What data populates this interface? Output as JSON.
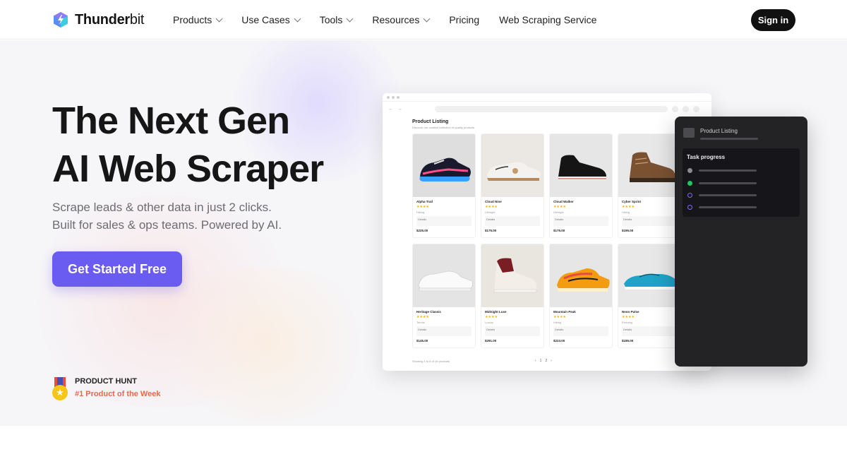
{
  "header": {
    "logo_bold": "Thunder",
    "logo_light": "bit",
    "nav": [
      {
        "label": "Products",
        "dropdown": true
      },
      {
        "label": "Use Cases",
        "dropdown": true
      },
      {
        "label": "Tools",
        "dropdown": true
      },
      {
        "label": "Resources",
        "dropdown": true
      },
      {
        "label": "Pricing",
        "dropdown": false
      },
      {
        "label": "Web Scraping Service",
        "dropdown": false
      }
    ],
    "signin_label": "Sign in"
  },
  "hero": {
    "title_line1": "The Next Gen",
    "title_line2": "AI Web Scraper",
    "subtitle_line1": "Scrape leads & other data in just 2 clicks.",
    "subtitle_line2": "Built for sales & ops teams. Powered by AI.",
    "cta_label": "Get Started Free",
    "badge_top": "PRODUCT HUNT",
    "badge_bottom": "#1 Product of the Week"
  },
  "mockup": {
    "listing_title": "Product Listing",
    "listing_subtitle": "Discover our curated collection of quality products",
    "products": [
      {
        "name": "Alpha Trail",
        "stars": "★★★★",
        "category": "Hiking",
        "price": "$225.00"
      },
      {
        "name": "Cloud Nine",
        "stars": "★★★★",
        "category": "Lifestyle",
        "price": "$175.00"
      },
      {
        "name": "Cloud Walker",
        "stars": "★★★★",
        "category": "Lifestyle",
        "price": "$175.00"
      },
      {
        "name": "Cyber Sprint",
        "stars": "★★★★",
        "category": "Hiking",
        "price": "$195.00"
      },
      {
        "name": "Heritage Classic",
        "stars": "★★★★",
        "category": "Tennis",
        "price": "$145.00"
      },
      {
        "name": "Midnight Luxe",
        "stars": "★★★★",
        "category": "Luxury",
        "price": "$291.00"
      },
      {
        "name": "Mountain Peak",
        "stars": "★★★★",
        "category": "Hiking",
        "price": "$223.00"
      },
      {
        "name": "Neon Pulse",
        "stars": "★★★★",
        "category": "Running",
        "price": "$185.00"
      }
    ],
    "product_desc": "Details",
    "footer_text": "Showing 1 to 8 of 16 products",
    "pager": [
      "‹",
      "1",
      "2",
      "›"
    ]
  },
  "panel": {
    "header_label": "Product Listing",
    "task_title": "Task progress",
    "task_rows": [
      {
        "status": "done",
        "color": "#8a8a90"
      },
      {
        "status": "active",
        "color": "#22c55e"
      },
      {
        "status": "pending",
        "color": "#7c6cf5"
      },
      {
        "status": "pending",
        "color": "#7c6cf5"
      }
    ]
  },
  "colors": {
    "accent": "#6a5cf0",
    "badge_text": "#e36a4a",
    "dark_panel": "#232326"
  }
}
